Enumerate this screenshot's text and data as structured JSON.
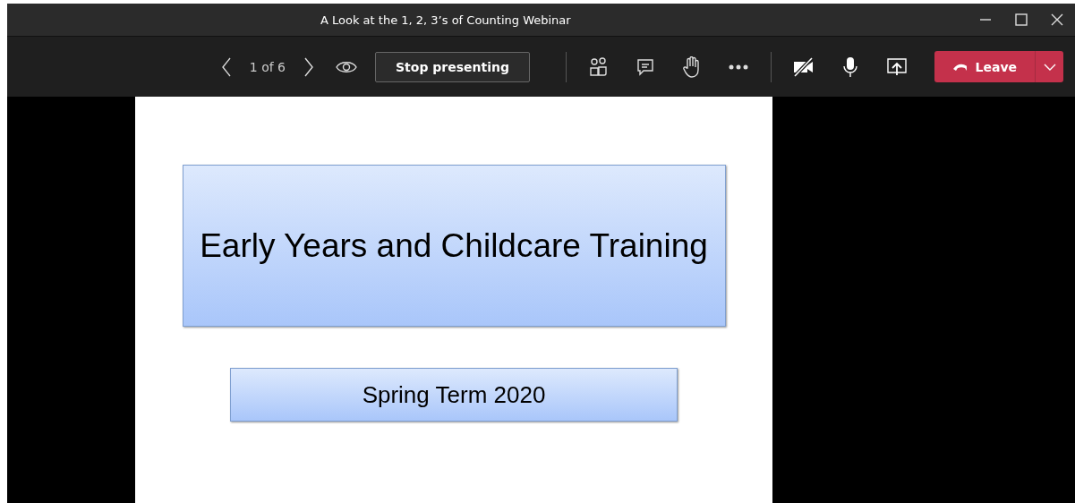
{
  "window": {
    "title": "A Look at the 1, 2, 3’s of Counting Webinar"
  },
  "toolbar": {
    "page_indicator": "1 of 6",
    "stop_button": "Stop presenting",
    "camera_on": false,
    "mic_muted": false,
    "leave_button": "Leave"
  },
  "slide": {
    "title": "Early Years and Childcare Training",
    "subtitle": "Spring Term 2020"
  }
}
